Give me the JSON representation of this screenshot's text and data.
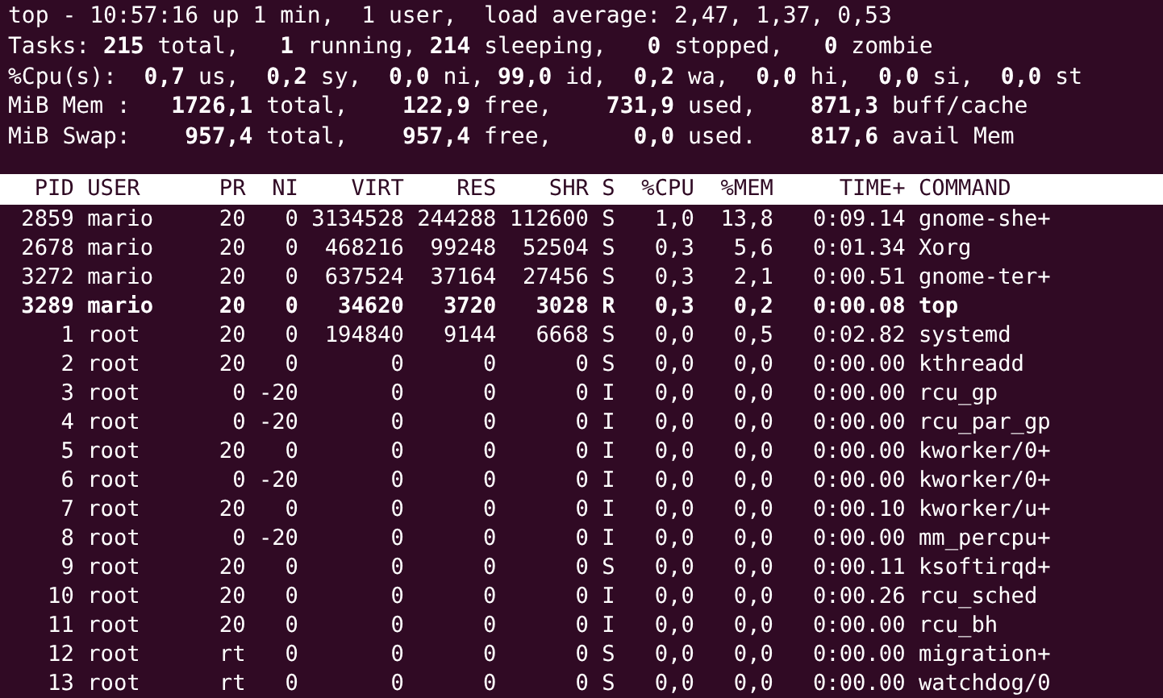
{
  "summary": [
    "top - 10:57:16 up 1 min,  1 user,  load average: 2,47, 1,37, 0,53",
    "Tasks: **215** total,   **1** running, **214** sleeping,   **0** stopped,   **0** zombie",
    "%Cpu(s):  **0,7** us,  **0,2** sy,  **0,0** ni, **99,0** id,  **0,2** wa,  **0,0** hi,  **0,0** si,  **0,0** st",
    "MiB Mem :   **1726,1** total,    **122,9** free,    **731,9** used,    **871,3** buff/cache",
    "MiB Swap:    **957,4** total,    **957,4** free,      **0,0** used.    **817,6** avail Mem"
  ],
  "table": {
    "columns": [
      "PID",
      "USER",
      "PR",
      "NI",
      "VIRT",
      "RES",
      "SHR",
      "S",
      "%CPU",
      "%MEM",
      "TIME+",
      "COMMAND"
    ],
    "rows": [
      {
        "highlighted": false,
        "cells": [
          "2859",
          "mario",
          "20",
          "0",
          "3134528",
          "244288",
          "112600",
          "S",
          "1,0",
          "13,8",
          "0:09.14",
          "gnome-she+"
        ]
      },
      {
        "highlighted": false,
        "cells": [
          "2678",
          "mario",
          "20",
          "0",
          "468216",
          "99248",
          "52504",
          "S",
          "0,3",
          "5,6",
          "0:01.34",
          "Xorg"
        ]
      },
      {
        "highlighted": false,
        "cells": [
          "3272",
          "mario",
          "20",
          "0",
          "637524",
          "37164",
          "27456",
          "S",
          "0,3",
          "2,1",
          "0:00.51",
          "gnome-ter+"
        ]
      },
      {
        "highlighted": true,
        "cells": [
          "3289",
          "mario",
          "20",
          "0",
          "34620",
          "3720",
          "3028",
          "R",
          "0,3",
          "0,2",
          "0:00.08",
          "top"
        ]
      },
      {
        "highlighted": false,
        "cells": [
          "1",
          "root",
          "20",
          "0",
          "194840",
          "9144",
          "6668",
          "S",
          "0,0",
          "0,5",
          "0:02.82",
          "systemd"
        ]
      },
      {
        "highlighted": false,
        "cells": [
          "2",
          "root",
          "20",
          "0",
          "0",
          "0",
          "0",
          "S",
          "0,0",
          "0,0",
          "0:00.00",
          "kthreadd"
        ]
      },
      {
        "highlighted": false,
        "cells": [
          "3",
          "root",
          "0",
          "-20",
          "0",
          "0",
          "0",
          "I",
          "0,0",
          "0,0",
          "0:00.00",
          "rcu_gp"
        ]
      },
      {
        "highlighted": false,
        "cells": [
          "4",
          "root",
          "0",
          "-20",
          "0",
          "0",
          "0",
          "I",
          "0,0",
          "0,0",
          "0:00.00",
          "rcu_par_gp"
        ]
      },
      {
        "highlighted": false,
        "cells": [
          "5",
          "root",
          "20",
          "0",
          "0",
          "0",
          "0",
          "I",
          "0,0",
          "0,0",
          "0:00.00",
          "kworker/0+"
        ]
      },
      {
        "highlighted": false,
        "cells": [
          "6",
          "root",
          "0",
          "-20",
          "0",
          "0",
          "0",
          "I",
          "0,0",
          "0,0",
          "0:00.00",
          "kworker/0+"
        ]
      },
      {
        "highlighted": false,
        "cells": [
          "7",
          "root",
          "20",
          "0",
          "0",
          "0",
          "0",
          "I",
          "0,0",
          "0,0",
          "0:00.10",
          "kworker/u+"
        ]
      },
      {
        "highlighted": false,
        "cells": [
          "8",
          "root",
          "0",
          "-20",
          "0",
          "0",
          "0",
          "I",
          "0,0",
          "0,0",
          "0:00.00",
          "mm_percpu+"
        ]
      },
      {
        "highlighted": false,
        "cells": [
          "9",
          "root",
          "20",
          "0",
          "0",
          "0",
          "0",
          "S",
          "0,0",
          "0,0",
          "0:00.11",
          "ksoftirqd+"
        ]
      },
      {
        "highlighted": false,
        "cells": [
          "10",
          "root",
          "20",
          "0",
          "0",
          "0",
          "0",
          "I",
          "0,0",
          "0,0",
          "0:00.26",
          "rcu_sched"
        ]
      },
      {
        "highlighted": false,
        "cells": [
          "11",
          "root",
          "20",
          "0",
          "0",
          "0",
          "0",
          "I",
          "0,0",
          "0,0",
          "0:00.00",
          "rcu_bh"
        ]
      },
      {
        "highlighted": false,
        "cells": [
          "12",
          "root",
          "rt",
          "0",
          "0",
          "0",
          "0",
          "S",
          "0,0",
          "0,0",
          "0:00.00",
          "migration+"
        ]
      },
      {
        "highlighted": false,
        "cells": [
          "13",
          "root",
          "rt",
          "0",
          "0",
          "0",
          "0",
          "S",
          "0,0",
          "0,0",
          "0:00.00",
          "watchdog/0"
        ]
      }
    ]
  }
}
